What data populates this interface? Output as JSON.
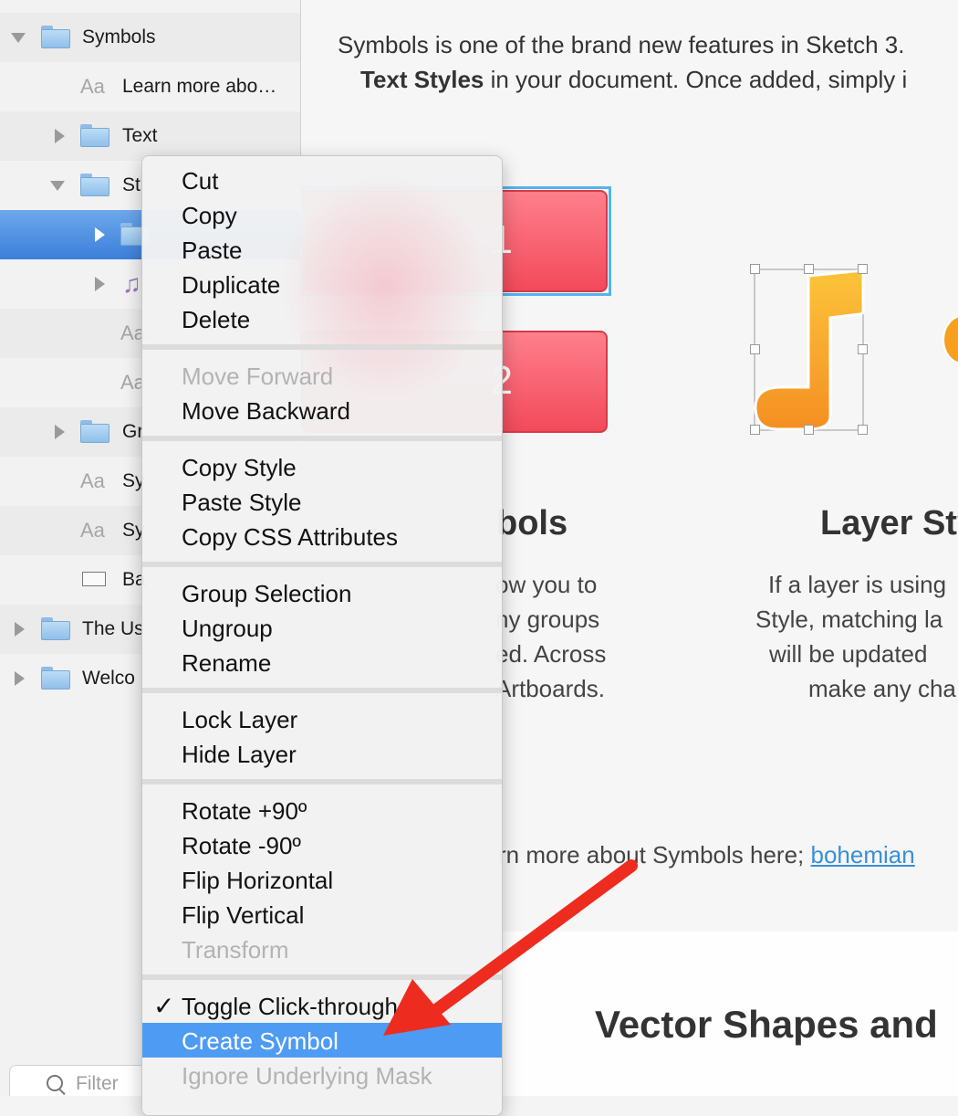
{
  "sidebar": {
    "rows": [
      {
        "label": "Symbols"
      },
      {
        "label": "Learn more abo…",
        "glyph": "Aa"
      },
      {
        "label": "Text"
      },
      {
        "label": "St"
      },
      {
        "label": ""
      },
      {
        "label": ""
      },
      {
        "label": "",
        "glyph": "Aa"
      },
      {
        "label": "",
        "glyph": "Aa"
      },
      {
        "label": "Gr"
      },
      {
        "label": "Sy",
        "glyph": "Aa"
      },
      {
        "label": "Sy",
        "glyph": "Aa"
      },
      {
        "label": "Ba"
      },
      {
        "label": "The Us"
      },
      {
        "label": "Welco"
      }
    ],
    "filter_placeholder": "Filter"
  },
  "canvas": {
    "intro_line1": "Symbols is one of the brand new features in Sketch 3.",
    "intro_line2_bold": "Text Styles",
    "intro_line2_rest": " in your document. Once added, simply i",
    "button1_label": "1",
    "button2_label": "2",
    "symbols_heading": "bols",
    "layer_styles_heading": "Layer Sty",
    "symbols_para": [
      "ow you to",
      "ny groups",
      "ed. Across",
      "Artboards."
    ],
    "layer_para": [
      "If a layer is using",
      "Style, matching la",
      "will be updated",
      "make any cha"
    ],
    "learn_more_text": "rn more about Symbols here; ",
    "learn_more_link": "bohemian",
    "vector_heading": "Vector Shapes and"
  },
  "menu": {
    "groups": [
      [
        {
          "label": "Cut"
        },
        {
          "label": "Copy"
        },
        {
          "label": "Paste"
        },
        {
          "label": "Duplicate"
        },
        {
          "label": "Delete"
        }
      ],
      [
        {
          "label": "Move Forward",
          "disabled": true
        },
        {
          "label": "Move Backward"
        }
      ],
      [
        {
          "label": "Copy Style"
        },
        {
          "label": "Paste Style"
        },
        {
          "label": "Copy CSS Attributes"
        }
      ],
      [
        {
          "label": "Group Selection"
        },
        {
          "label": "Ungroup"
        },
        {
          "label": "Rename"
        }
      ],
      [
        {
          "label": "Lock Layer"
        },
        {
          "label": "Hide Layer"
        }
      ],
      [
        {
          "label": "Rotate +90º"
        },
        {
          "label": "Rotate -90º"
        },
        {
          "label": "Flip Horizontal"
        },
        {
          "label": "Flip Vertical"
        },
        {
          "label": "Transform",
          "disabled": true
        }
      ],
      [
        {
          "label": "Toggle Click-through",
          "checked": true
        },
        {
          "label": "Create Symbol",
          "highlighted": true
        },
        {
          "label": "Ignore Underlying Mask",
          "disabled": true
        }
      ]
    ],
    "checkmark": "✓"
  },
  "colors": {
    "selection_blue": "#4e9bf3",
    "annotation_arrow": "#ee2b1f",
    "button_red": "#f24a5b",
    "note_orange": "#f9a32a"
  }
}
